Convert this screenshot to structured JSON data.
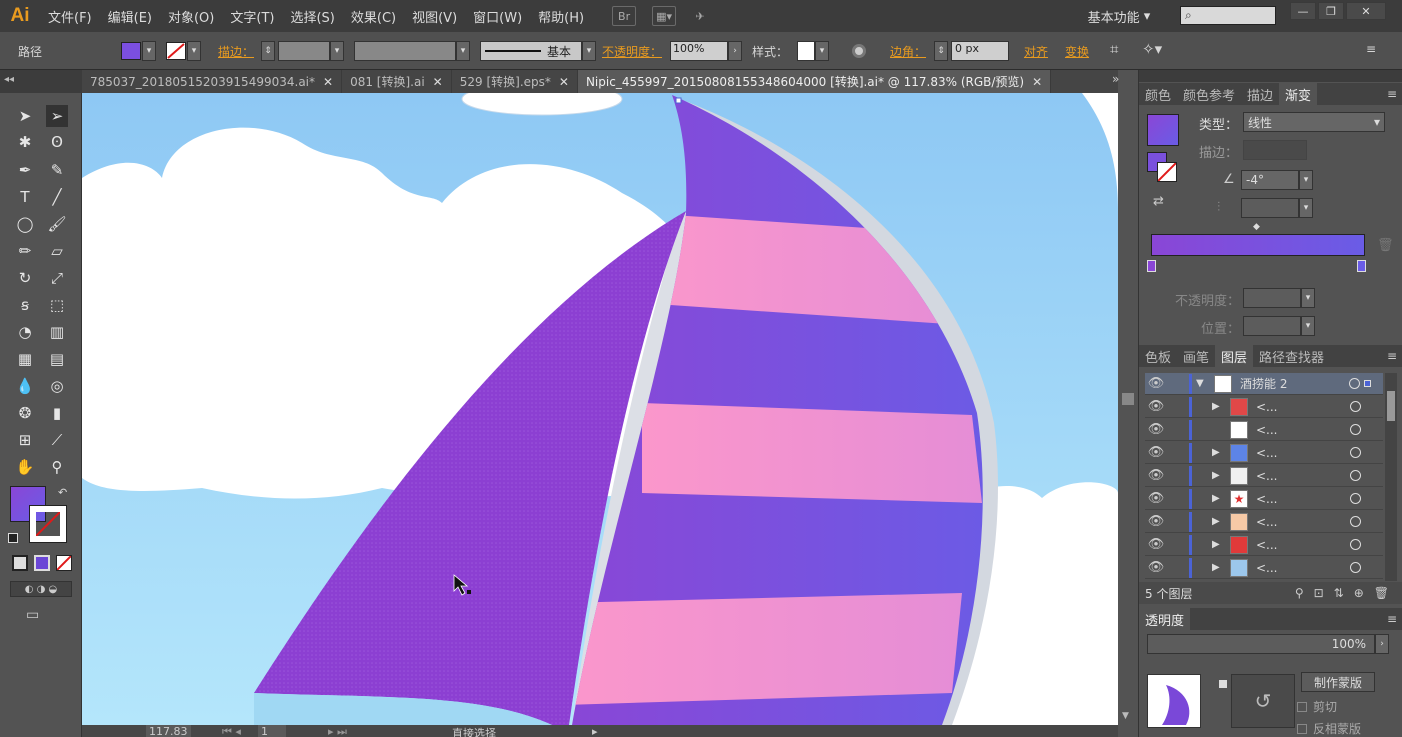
{
  "app": {
    "logo": "Ai",
    "workspace": "基本功能"
  },
  "menu": [
    "文件(F)",
    "编辑(E)",
    "对象(O)",
    "文字(T)",
    "选择(S)",
    "效果(C)",
    "视图(V)",
    "窗口(W)",
    "帮助(H)"
  ],
  "control": {
    "object_type": "路径",
    "stroke_label": "描边：",
    "stroke_profile": "基本",
    "opacity_label": "不透明度：",
    "opacity_value": "100%",
    "style_label": "样式：",
    "corner_label": "边角：",
    "corner_value": "0 px",
    "align_label": "对齐",
    "transform_label": "变换"
  },
  "tabs": [
    {
      "label": "785037_20180515203915499034.ai*"
    },
    {
      "label": "081 [转换].ai"
    },
    {
      "label": "529 [转换].eps*"
    },
    {
      "label": "Nipic_455997_20150808155348604000 [转换].ai* @ 117.83% (RGB/预览)"
    }
  ],
  "gradient_panel": {
    "tabs": [
      "颜色",
      "颜色参考",
      "描边",
      "渐变"
    ],
    "type_label": "类型：",
    "type_value": "线性",
    "stroke_label": "描边：",
    "angle_value": "-4°",
    "opacity_label": "不透明度：",
    "position_label": "位置：",
    "start_color": "#8a46d6",
    "end_color": "#6a5ce6"
  },
  "layers_panel": {
    "tabs": [
      "色板",
      "画笔",
      "图层",
      "路径查找器"
    ],
    "top_layer": "酒捞能 2",
    "sublayer_name": "<...",
    "count": "5 个图层"
  },
  "transparency_panel": {
    "tab": "透明度",
    "opacity_value": "100%",
    "make_mask": "制作蒙版",
    "clip_label": "剪切",
    "invert_label": "反相蒙版"
  },
  "status": {
    "zoom": "117.83",
    "page": "1",
    "tool_name": "直接选择"
  },
  "colors": {
    "sky": "#9fd0f6",
    "sail_purple": "#8a3fcf",
    "stripe_pink": "#f19ad0",
    "stripe_purple": "#7a4fd8",
    "accent_orange": "#e99b1f"
  }
}
